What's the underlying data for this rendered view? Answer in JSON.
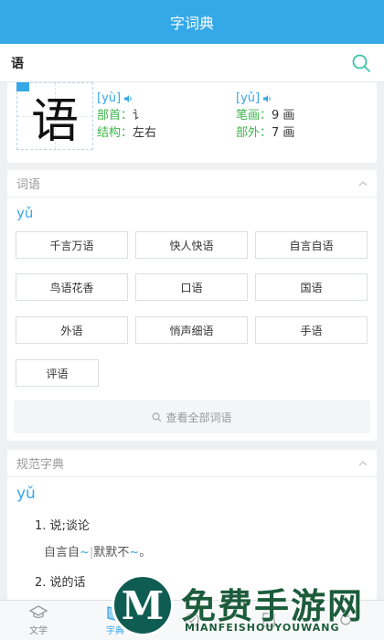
{
  "header": {
    "title": "字词典"
  },
  "search": {
    "value": "语"
  },
  "character": {
    "glyph": "语",
    "pinyin_1": "[yù]",
    "pinyin_2": "[yǔ]",
    "radical_label": "部首：",
    "radical_value": "讠",
    "strokes_label": "笔画：",
    "strokes_value": "9 画",
    "structure_label": "结构：",
    "structure_value": "左右",
    "outer_label": "部外：",
    "outer_value": "7 画"
  },
  "words_section": {
    "title": "词语",
    "pinyin": "yǔ",
    "words": [
      "千言万语",
      "快人快语",
      "自言自语",
      "鸟语花香",
      "口语",
      "国语",
      "外语",
      "悄声细语",
      "手语",
      "评语"
    ],
    "view_all": "查看全部词语"
  },
  "dict_section": {
    "title": "规范字典",
    "pinyin": "yǔ",
    "def1": "1. 说;谈论",
    "ex1_a": "自言自",
    "ex1_sep": "|",
    "ex1_b": "默默不",
    "ex1_end": "。",
    "def2": "2. 说的话",
    "tilde": "~"
  },
  "nav": {
    "items": [
      {
        "label": "文学"
      },
      {
        "label": "字典"
      },
      {
        "label": ""
      },
      {
        "label": ""
      },
      {
        "label": ""
      }
    ]
  },
  "watermark": {
    "title": "免费手游网",
    "sub": "MIANFEISHOUYOUWANG",
    "logo": "M"
  },
  "colors": {
    "primary": "#35a8e8",
    "label_green": "#3bb54a"
  }
}
